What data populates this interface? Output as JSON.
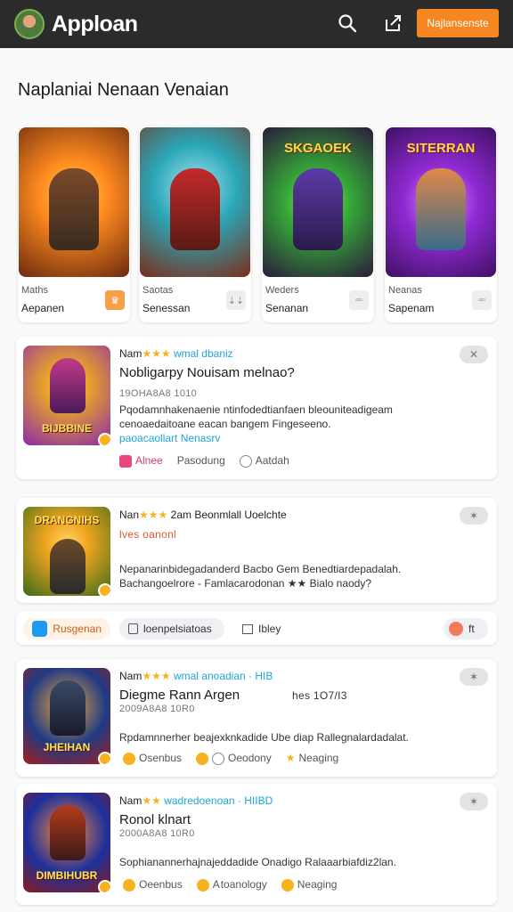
{
  "app": {
    "title": "Apploan",
    "cta_label": "Najlansenste"
  },
  "icons": {
    "search": "search-icon",
    "share": "share-icon",
    "avatar": "avatar"
  },
  "heading": "Naplaniai Nenaan Venaian",
  "featured": [
    {
      "title_art": "",
      "name": "Maths",
      "sub": "Aepanen",
      "badge": "♛",
      "colors": [
        "#ff9a1f",
        "#6b2a0e"
      ]
    },
    {
      "title_art": "",
      "name": "Saotas",
      "sub": "Senessan",
      "badge": "⇣⇣",
      "colors": [
        "#2aa7b8",
        "#7b2d1a"
      ]
    },
    {
      "title_art": "SKGAOEK",
      "name": "Weders",
      "sub": "Senanan",
      "badge": "▫▫",
      "colors": [
        "#35a837",
        "#2a1a3b"
      ]
    },
    {
      "title_art": "SITERRAN",
      "name": "Neanas",
      "sub": "Sapenam",
      "badge": "▫▫",
      "colors": [
        "#8f2ad2",
        "#3f1064"
      ]
    }
  ],
  "list": [
    {
      "meta_prefix": "Nam",
      "stars": "★★★",
      "meta_tag": "wmal dbaniz",
      "title": "Nobligarpy Nouisam melnao?",
      "small": "19OHA8A8 1010",
      "desc1": "Pqodamnhakenaenie ntinfodedtianfaen bleouniteadigeam",
      "desc2": "cenoaedaitoane eacan bangem Fingeseeno.",
      "link": "paoacaollart Nenasrv",
      "actions": [
        "Alnee",
        "Pasodung",
        "Aatdah"
      ],
      "pill": "✕",
      "art": "BIJBBINE",
      "colors": [
        "#e8a22a",
        "#8a2aa8"
      ]
    },
    {
      "meta_prefix": "Nan",
      "stars": "★★★",
      "meta_tag": "2am Beonmlall Uoelchte",
      "title": "",
      "small": "lves oanonl",
      "desc1": "Nepanarinbidegadanderd Bacbo Gem Benedtiardepadalah.",
      "desc2": "Bachangoelrore - Famlacarodonan ★★ Bialo naody?",
      "link": "",
      "actions": [],
      "pill": "✶",
      "art": "DRANGNIHS",
      "colors": [
        "#f2a61f",
        "#3c6a1b"
      ]
    },
    {
      "meta_prefix": "Nam",
      "stars": "★★★",
      "meta_tag": "wmal anoadian · HIB",
      "title": "Diegme Rann Argen",
      "title_right": "hes 1O7/I3",
      "small": "2009A8A8 10R0",
      "desc1": "Rpdamnnerher beajexknkadide Ube diap Rallegnalardadalat.",
      "desc2": "",
      "link": "",
      "actions": [
        "Osenbus",
        "Oeodony",
        "Neaging"
      ],
      "pill": "✶",
      "art": "JHEIHAN",
      "colors": [
        "#1f3a84",
        "#a81d1d"
      ]
    },
    {
      "meta_prefix": "Nam",
      "stars": "★★",
      "meta_tag": "wadredoenoan · HIIBD",
      "title": "Ronol klnart",
      "title_right": "",
      "small": "2000A8A8 10R0",
      "desc1": "Sophianannerhajnajeddadide Onadigo Ralaaarbiafdiz2lan.",
      "desc2": "",
      "link": "",
      "actions": [
        "Oeenbus",
        "A toanology",
        "Neaging"
      ],
      "pill": "✶",
      "art": "DIMBIHUBR",
      "colors": [
        "#1d2f9b",
        "#8b1c1c"
      ]
    }
  ],
  "share": {
    "twitter": "Rusgenan",
    "copy": "loenpelsiatoas",
    "export": "Ibley",
    "count": "ft"
  }
}
